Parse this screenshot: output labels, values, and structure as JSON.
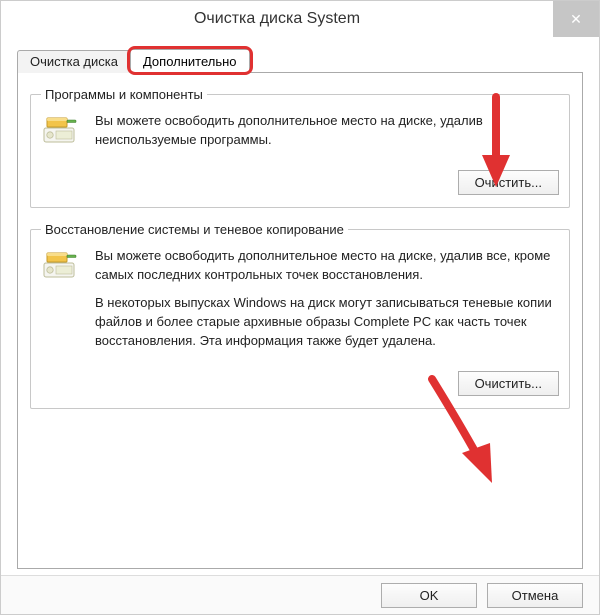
{
  "window": {
    "title": "Очистка диска System",
    "close_glyph": "✕"
  },
  "tabs": {
    "tab1_label": "Очистка диска",
    "tab2_label": "Дополнительно"
  },
  "group1": {
    "legend": "Программы и компоненты",
    "text": "Вы можете освободить дополнительное место на диске, удалив неиспользуемые программы.",
    "button": "Очистить..."
  },
  "group2": {
    "legend": "Восстановление системы и теневое копирование",
    "text1": "Вы можете освободить дополнительное место на диске, удалив все, кроме самых последних контрольных точек восстановления.",
    "text2": "В некоторых выпусках Windows на диск могут записываться теневые копии файлов и более старые архивные образы Complete PC как часть точек восстановления. Эта информация также будет удалена.",
    "button": "Очистить..."
  },
  "footer": {
    "ok": "OK",
    "cancel": "Отмена"
  }
}
